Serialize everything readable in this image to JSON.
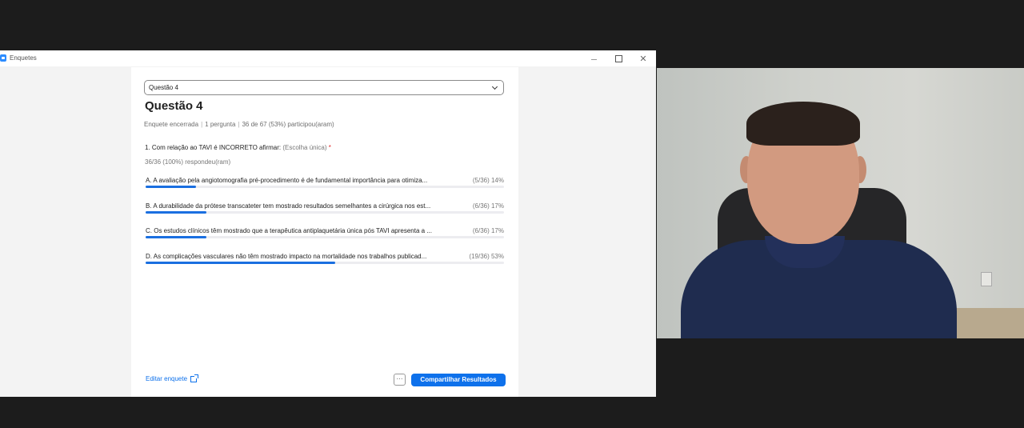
{
  "window": {
    "title": "Enquetes",
    "controls": {
      "minimize": "–",
      "maximize": "□",
      "close": "✕"
    }
  },
  "poll": {
    "selector_value": "Questão 4",
    "title": "Questão 4",
    "meta": {
      "status": "Enquete encerrada",
      "questions": "1 pergunta",
      "participation": "36 de 67 (53%) participou(aram)"
    },
    "question": {
      "text": "1. Com relação ao TAVI é INCORRETO afirmar:",
      "type": "(Escolha única)",
      "required_mark": "*",
      "answered": "36/36 (100%) respondeu(ram)"
    },
    "options": [
      {
        "label": "A. A avaliação pela angiotomografia pré-procedimento é de fundamental importância para otimiza...",
        "count": "(5/36) 14%",
        "fraction": 0.14
      },
      {
        "label": "B. A durabilidade da prótese transcateter tem mostrado resultados semelhantes a cirúrgica nos est...",
        "count": "(6/36) 17%",
        "fraction": 0.17
      },
      {
        "label": "C. Os estudos clínicos têm mostrado que a terapêutica antiplaquetária única pós TAVI apresenta a ...",
        "count": "(6/36) 17%",
        "fraction": 0.17
      },
      {
        "label": "D. As complicações vasculares não têm mostrado impacto na mortalidade nos trabalhos publicad...",
        "count": "(19/36) 53%",
        "fraction": 0.53
      }
    ],
    "footer": {
      "edit_label": "Editar enquete",
      "more_label": "···",
      "share_label": "Compartilhar Resultados"
    }
  },
  "colors": {
    "accent": "#0e71eb",
    "bar_fill": "#1a6fe0",
    "bar_track": "#ececf0",
    "required": "#e02828"
  },
  "icons": [
    "zoom-app-icon",
    "chevron-down-icon",
    "external-link-icon"
  ]
}
